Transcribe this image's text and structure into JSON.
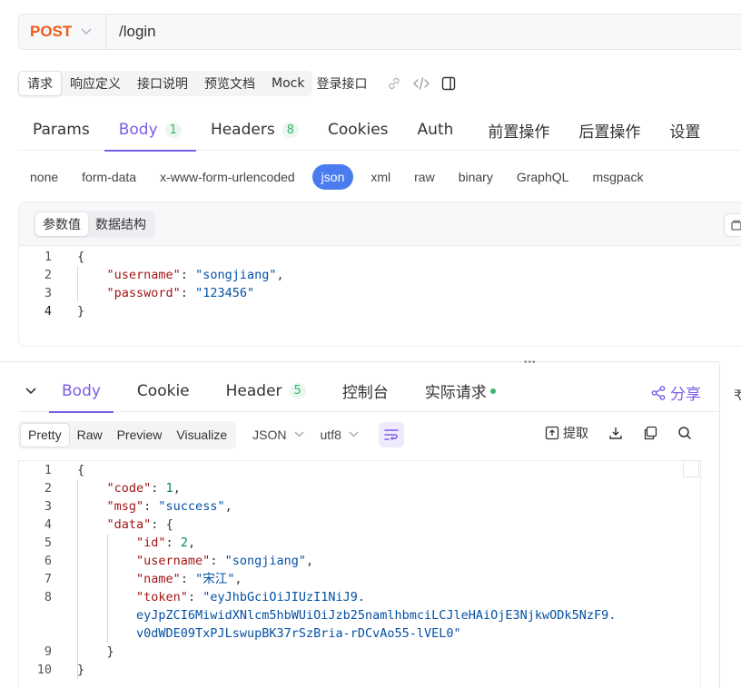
{
  "request": {
    "method": "POST",
    "path": "/login"
  },
  "request_tabs": {
    "items": [
      "请求",
      "响应定义",
      "接口说明",
      "预览文档",
      "Mock"
    ],
    "title": "登录接口"
  },
  "main_tabs": {
    "params": "Params",
    "body": "Body",
    "body_count": "1",
    "headers": "Headers",
    "headers_count": "8",
    "cookies": "Cookies",
    "auth": "Auth",
    "pre": "前置操作",
    "post": "后置操作",
    "settings": "设置"
  },
  "body_types": [
    "none",
    "form-data",
    "x-www-form-urlencoded",
    "json",
    "xml",
    "raw",
    "binary",
    "GraphQL",
    "msgpack"
  ],
  "body_type_selected": "json",
  "editor": {
    "seg_value": "参数值",
    "seg_schema": "数据结构",
    "line_numbers": [
      "1",
      "2",
      "3",
      "4"
    ],
    "open_brace": "{",
    "close_brace": "}",
    "key_username": "\"username\"",
    "val_username": "\"songjiang\"",
    "key_password": "\"password\"",
    "val_password": "\"123456\""
  },
  "response_tabs": {
    "body": "Body",
    "cookie": "Cookie",
    "header": "Header",
    "header_count": "5",
    "console": "控制台",
    "actual": "实际请求",
    "share": "分享"
  },
  "response_toolbar": {
    "views": [
      "Pretty",
      "Raw",
      "Preview",
      "Visualize"
    ],
    "format": "JSON",
    "encoding": "utf8",
    "extract": "提取"
  },
  "response_code": {
    "line_numbers": [
      "1",
      "2",
      "3",
      "4",
      "5",
      "6",
      "7",
      "8",
      "",
      "",
      "9",
      "10"
    ],
    "open_brace": "{",
    "close_brace": "}",
    "key_code": "\"code\"",
    "val_code": "1",
    "key_msg": "\"msg\"",
    "val_msg": "\"success\"",
    "key_data": "\"data\"",
    "key_id": "\"id\"",
    "val_id": "2",
    "key_username": "\"username\"",
    "val_username": "\"songjiang\"",
    "key_name": "\"name\"",
    "val_name": "\"宋江\"",
    "key_token": "\"token\"",
    "val_token_1": "\"eyJhbGciOiJIUzI1NiJ9.",
    "val_token_2": "eyJpZCI6MiwidXNlcm5hbWUiOiJzb25namlhbmciLCJleHAiOjE3NjkwODk5NzF9.",
    "val_token_3": "v0dWDE09TxPJLswupBK37rSzBria-rDCvAo55-lVEL0\"",
    "data_close": "}"
  },
  "right_edge_glyph": "₹",
  "colors": {
    "accent": "#7b5ce5",
    "method": "#f05a1a",
    "json_selected": "#4a7cf0",
    "badge_green": "#3bb46e",
    "json_key": "#a31515",
    "json_string": "#0451a5",
    "json_number": "#098658"
  }
}
